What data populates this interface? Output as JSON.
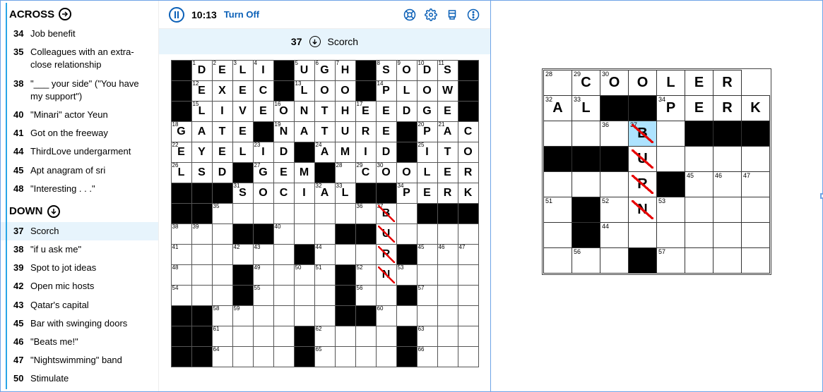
{
  "toolbar": {
    "time": "10:13",
    "turn_off": "Turn Off"
  },
  "cluebar": {
    "num": "37",
    "direction_glyph": "↓",
    "text": "Scorch"
  },
  "sections": {
    "across": "ACROSS",
    "down": "DOWN"
  },
  "across_clues": [
    {
      "num": "34",
      "text": "Job benefit"
    },
    {
      "num": "35",
      "text": "Colleagues with an extra-close relationship",
      "marker": true
    },
    {
      "num": "38",
      "text": "\"___ your side\" (\"You have my support\")"
    },
    {
      "num": "40",
      "text": "\"Minari\" actor Yeun"
    },
    {
      "num": "41",
      "text": "Got on the freeway"
    },
    {
      "num": "44",
      "text": "ThirdLove undergarment"
    },
    {
      "num": "45",
      "text": "Apt anagram of sri"
    },
    {
      "num": "48",
      "text": "\"Interesting . . .\""
    }
  ],
  "down_clues": [
    {
      "num": "37",
      "text": "Scorch",
      "selected": true
    },
    {
      "num": "38",
      "text": "\"if u ask me\""
    },
    {
      "num": "39",
      "text": "Spot to jot ideas"
    },
    {
      "num": "42",
      "text": "Open mic hosts"
    },
    {
      "num": "43",
      "text": "Qatar's capital"
    },
    {
      "num": "45",
      "text": "Bar with swinging doors"
    },
    {
      "num": "46",
      "text": "\"Beats me!\""
    },
    {
      "num": "47",
      "text": "\"Nightswimming\" band"
    },
    {
      "num": "50",
      "text": "Stimulate"
    }
  ],
  "grid": [
    [
      "#",
      {
        "n": "1",
        "l": "D"
      },
      {
        "n": "2",
        "l": "E"
      },
      {
        "n": "3",
        "l": "L"
      },
      {
        "n": "4",
        "l": "I"
      },
      "#",
      {
        "n": "5",
        "l": "U"
      },
      {
        "n": "6",
        "l": "G"
      },
      {
        "n": "7",
        "l": "H"
      },
      "#",
      {
        "n": "8",
        "l": "S"
      },
      {
        "n": "9",
        "l": "O"
      },
      {
        "n": "10",
        "l": "D"
      },
      {
        "n": "11",
        "l": "S"
      },
      "#"
    ],
    [
      "#",
      {
        "n": "12",
        "l": "E"
      },
      {
        "l": "X"
      },
      {
        "l": "E"
      },
      {
        "l": "C"
      },
      "#",
      {
        "n": "13",
        "l": "L"
      },
      {
        "l": "O"
      },
      {
        "l": "O"
      },
      "#",
      {
        "n": "14",
        "l": "P"
      },
      {
        "l": "L"
      },
      {
        "l": "O"
      },
      {
        "l": "W"
      },
      "#"
    ],
    [
      "#",
      {
        "n": "15",
        "l": "L"
      },
      {
        "l": "I"
      },
      {
        "l": "V"
      },
      {
        "l": "E"
      },
      {
        "n": "16",
        "l": "O"
      },
      {
        "l": "N"
      },
      {
        "l": "T"
      },
      {
        "l": "H"
      },
      {
        "n": "17",
        "l": "E"
      },
      {
        "l": "E"
      },
      {
        "l": "D"
      },
      {
        "l": "G"
      },
      {
        "l": "E"
      },
      "#"
    ],
    [
      {
        "n": "18",
        "l": "G"
      },
      {
        "l": "A"
      },
      {
        "l": "T"
      },
      {
        "l": "E"
      },
      "#",
      {
        "n": "19",
        "l": "N"
      },
      {
        "l": "A"
      },
      {
        "l": "T"
      },
      {
        "l": "U"
      },
      {
        "l": "R"
      },
      {
        "l": "E"
      },
      "#",
      {
        "n": "20",
        "l": "P"
      },
      {
        "n": "21",
        "l": "A"
      },
      {
        "l": "C"
      }
    ],
    [
      {
        "n": "22",
        "l": "E"
      },
      {
        "l": "Y"
      },
      {
        "l": "E"
      },
      {
        "l": "L"
      },
      {
        "n": "23",
        "l": "I"
      },
      {
        "l": "D"
      },
      "#",
      {
        "n": "24",
        "l": "A"
      },
      {
        "l": "M"
      },
      {
        "l": "I"
      },
      {
        "l": "D"
      },
      "#",
      {
        "n": "25",
        "l": "I"
      },
      {
        "l": "T"
      },
      {
        "l": "O"
      }
    ],
    [
      {
        "n": "26",
        "l": "L"
      },
      {
        "l": "S"
      },
      {
        "l": "D"
      },
      "#",
      {
        "n": "27",
        "l": "G"
      },
      {
        "l": "E"
      },
      {
        "l": "M"
      },
      "#",
      {
        "n": "28"
      },
      {
        "n": "29",
        "l": "C"
      },
      {
        "n": "30",
        "l": "O"
      },
      {
        "l": "O"
      },
      {
        "l": "L"
      },
      {
        "l": "E"
      },
      {
        "l": "R"
      }
    ],
    [
      "#",
      "#",
      "#",
      {
        "n": "31",
        "l": "S"
      },
      {
        "l": "O"
      },
      {
        "l": "C"
      },
      {
        "l": "I"
      },
      {
        "n": "32",
        "l": "A"
      },
      {
        "n": "33",
        "l": "L"
      },
      "#",
      "#",
      {
        "n": "34",
        "l": "P"
      },
      {
        "l": "E"
      },
      {
        "l": "R"
      },
      {
        "l": "K"
      }
    ],
    [
      "#",
      "#",
      {
        "n": "35"
      },
      {},
      {},
      {},
      {},
      {},
      {},
      {
        "n": "36"
      },
      {
        "n": "37",
        "l": "B",
        "cls": "hl-cell red-slash"
      },
      {},
      "#",
      "#",
      "#"
    ],
    [
      {
        "n": "38"
      },
      {
        "n": "39"
      },
      {},
      "#",
      "#",
      {
        "n": "40"
      },
      {},
      {},
      "#",
      "#",
      {
        "l": "U",
        "cls": "sel-word red-slash"
      },
      {},
      {},
      {},
      {}
    ],
    [
      {
        "n": "41"
      },
      {},
      {},
      {
        "n": "42"
      },
      {
        "n": "43"
      },
      {},
      "#",
      {
        "n": "44"
      },
      {},
      {},
      {
        "l": "R",
        "cls": "sel-word red-slash"
      },
      "#",
      {
        "n": "45"
      },
      {
        "n": "46"
      },
      {
        "n": "47"
      }
    ],
    [
      {
        "n": "48"
      },
      {},
      {},
      "#",
      {
        "n": "49"
      },
      {},
      {
        "n": "50"
      },
      {
        "n": "51"
      },
      "#",
      {
        "n": "52"
      },
      {
        "l": "N",
        "cls": "sel-word red-slash"
      },
      {
        "n": "53"
      },
      {},
      {},
      {}
    ],
    [
      {
        "n": "54"
      },
      {},
      {},
      "#",
      {
        "n": "55"
      },
      {},
      {},
      {},
      "#",
      {
        "n": "56"
      },
      {},
      "#",
      {
        "n": "57"
      },
      {},
      {}
    ],
    [
      "#",
      "#",
      {
        "n": "58"
      },
      {
        "n": "59"
      },
      {},
      {},
      {},
      {},
      "#",
      "#",
      {
        "n": "60"
      },
      {},
      {},
      {},
      {}
    ],
    [
      "#",
      "#",
      {
        "n": "61"
      },
      {},
      {},
      {},
      "#",
      {
        "n": "62"
      },
      {},
      {},
      {},
      "#",
      {
        "n": "63"
      },
      {},
      {}
    ],
    [
      "#",
      "#",
      {
        "n": "64"
      },
      {},
      {},
      {},
      "#",
      {
        "n": "65"
      },
      {},
      {},
      {},
      "#",
      {
        "n": "66"
      },
      {},
      {}
    ]
  ],
  "zoom_grid": [
    [
      {
        "n": "28"
      },
      {
        "n": "29",
        "l": "C"
      },
      {
        "n": "30",
        "l": "O"
      },
      {
        "l": "O"
      },
      {
        "l": "L"
      },
      {
        "l": "E"
      },
      {
        "l": "R"
      }
    ],
    [
      {
        "n": "32",
        "l": "A"
      },
      {
        "n": "33",
        "l": "L"
      },
      "#",
      "#",
      {
        "n": "34",
        "l": "P"
      },
      {
        "l": "E"
      },
      {
        "l": "R"
      },
      {
        "l": "K"
      }
    ],
    [
      {},
      {},
      {
        "n": "36"
      },
      {
        "n": "37",
        "l": "B",
        "cls": "hl-cell red-slash"
      },
      {},
      "#",
      "#",
      "#"
    ],
    [
      "#",
      "#",
      "#",
      {
        "l": "U",
        "cls": "red-slash"
      },
      {},
      {},
      {},
      {}
    ],
    [
      {},
      {},
      {},
      {
        "l": "R",
        "cls": "red-slash"
      },
      "#",
      {
        "n": "45"
      },
      {
        "n": "46"
      },
      {
        "n": "47"
      }
    ],
    [
      {
        "n": "51"
      },
      "#",
      {
        "n": "52"
      },
      {
        "l": "N",
        "cls": "red-slash"
      },
      {
        "n": "53"
      },
      {},
      {},
      {}
    ],
    [
      {},
      "#",
      {
        "n": "44"
      },
      {},
      {},
      {},
      {},
      {}
    ],
    [
      {},
      {
        "n": "56"
      },
      {},
      "#",
      {
        "n": "57"
      },
      {},
      {},
      {}
    ]
  ]
}
